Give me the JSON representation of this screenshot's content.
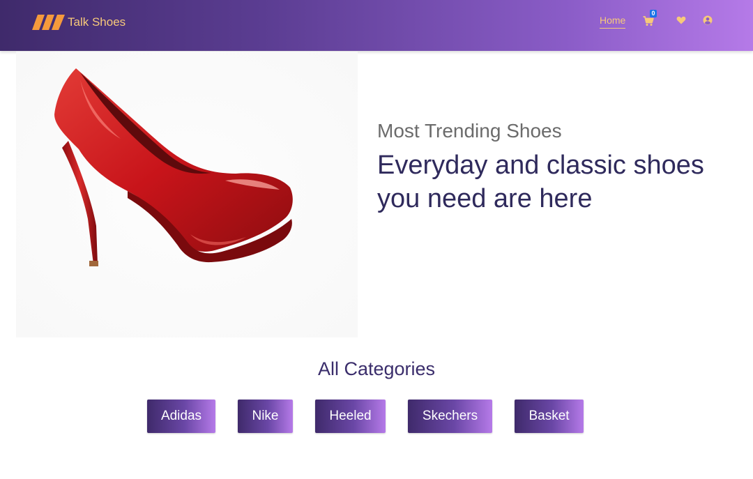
{
  "navbar": {
    "brand_name": "Talk Shoes",
    "logo_icon": "stripes-logo-icon",
    "home_label": "Home",
    "cart_icon": "cart-icon",
    "cart_count": "0",
    "wishlist_icon": "heart-icon",
    "account_icon": "user-circle-icon"
  },
  "hero": {
    "image": "red-high-heel-shoe",
    "subtitle": "Most Trending Shoes",
    "title": "Everyday and classic shoes you need are here"
  },
  "categories": {
    "title": "All Categories",
    "items": [
      {
        "label": "Adidas"
      },
      {
        "label": "Nike"
      },
      {
        "label": "Heeled"
      },
      {
        "label": "Skechers"
      },
      {
        "label": "Basket"
      }
    ]
  },
  "colors": {
    "nav_gradient_start": "#3f2a6b",
    "nav_gradient_end": "#b57ae8",
    "brand_accent": "#f7c97a",
    "heading_text": "#2f2a5c",
    "badge": "#1a73e8"
  }
}
